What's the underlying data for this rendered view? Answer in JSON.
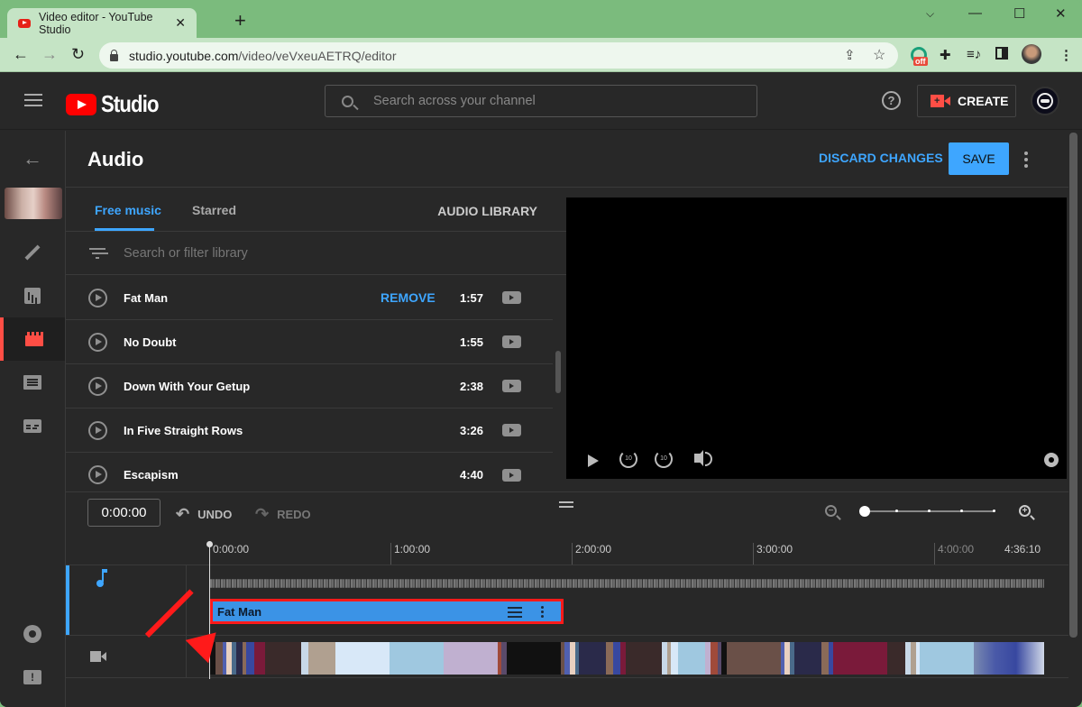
{
  "browser": {
    "tab_title": "Video editor - YouTube Studio",
    "url_host": "studio.youtube.com",
    "url_path": "/video/veVxeuAETRQ/editor",
    "extension_badge": "off"
  },
  "header": {
    "logo_text": "Studio",
    "search_placeholder": "Search across your channel",
    "help_label": "?",
    "create_label": "CREATE"
  },
  "page": {
    "title": "Audio",
    "discard_label": "DISCARD CHANGES",
    "save_label": "SAVE"
  },
  "sidebar": {
    "items": [
      {
        "icon": "back-arrow-icon"
      },
      {
        "icon": "video-thumbnail"
      },
      {
        "icon": "pencil-icon",
        "label": "Details"
      },
      {
        "icon": "analytics-icon",
        "label": "Analytics"
      },
      {
        "icon": "editor-icon",
        "label": "Editor",
        "active": true
      },
      {
        "icon": "comments-icon",
        "label": "Comments"
      },
      {
        "icon": "subtitles-icon",
        "label": "Subtitles"
      },
      {
        "icon": "settings-icon",
        "label": "Settings"
      },
      {
        "icon": "feedback-icon",
        "label": "Send feedback"
      }
    ]
  },
  "audio": {
    "tabs": [
      {
        "label": "Free music",
        "active": true
      },
      {
        "label": "Starred",
        "active": false
      }
    ],
    "library_label": "AUDIO LIBRARY",
    "filter_placeholder": "Search or filter library",
    "tracks": [
      {
        "name": "Fat Man",
        "duration": "1:57",
        "action": "REMOVE"
      },
      {
        "name": "No Doubt",
        "duration": "1:55"
      },
      {
        "name": "Down With Your Getup",
        "duration": "2:38"
      },
      {
        "name": "In Five Straight Rows",
        "duration": "3:26"
      },
      {
        "name": "Escapism",
        "duration": "4:40"
      }
    ]
  },
  "player": {
    "controls": [
      "play-icon",
      "rewind-10-icon",
      "forward-10-icon",
      "volume-icon",
      "settings-icon"
    ],
    "rewind_label": "10",
    "forward_label": "10"
  },
  "timeline": {
    "current_time": "0:00:00",
    "undo_label": "UNDO",
    "redo_label": "REDO",
    "zoom_level_step": 0,
    "zoom_level_steps": 5,
    "ruler": [
      "0:00:00",
      "1:00:00",
      "2:00:00",
      "3:00:00",
      "4:00:00",
      "4:36:10"
    ],
    "audio_clip_name": "Fat Man"
  },
  "colors": {
    "accent": "#3ea6ff",
    "brand_red": "#ff0000",
    "active_red": "#ff4e45",
    "highlight": "#ff1a1a"
  }
}
